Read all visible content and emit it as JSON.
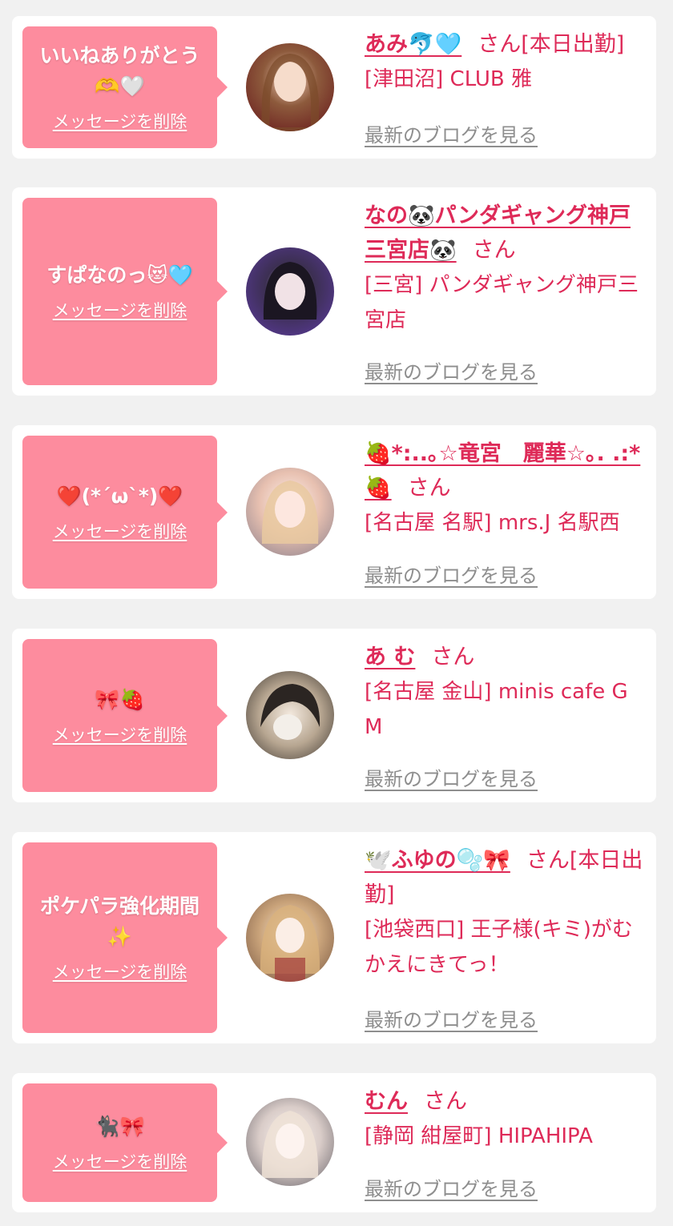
{
  "colors": {
    "page_bg": "#f1f1f1",
    "card_bg": "#ffffff",
    "bubble_bg": "#fd8c9e",
    "accent": "#de2a58",
    "muted": "#8e8e8e"
  },
  "delete_label": "メッセージを削除",
  "blog_label": "最新のブログを見る",
  "honorific": "さん",
  "items": [
    {
      "message": "いいねありがとう🫶🤍",
      "cast_name": "あみ🐬🩵",
      "status": "[本日出勤]",
      "shop": "[津田沼] CLUB 雅",
      "avatar_icon": "avatar-photo"
    },
    {
      "message": "すぱなのっ😻🩵",
      "cast_name": "なの🐼パンダギャング神戸三宮店🐼",
      "status": "",
      "shop": "[三宮] パンダギャング神戸三宮店",
      "avatar_icon": "avatar-photo"
    },
    {
      "message": "❤️(*´ω`*)❤️",
      "cast_name": "🍓*:..｡☆竜宮　麗華☆｡. .:*🍓",
      "status": "",
      "shop": "[名古屋 名駅] mrs.J 名駅西",
      "avatar_icon": "avatar-photo"
    },
    {
      "message": "🎀🍓",
      "cast_name": "あ む",
      "status": "",
      "shop": "[名古屋 金山] minis cafe GM",
      "avatar_icon": "avatar-photo"
    },
    {
      "message": "ポケパラ強化期間✨",
      "cast_name": "🕊️ふゆの🫧🎀",
      "status": "[本日出勤]",
      "shop": "[池袋西口] 王子様(キミ)がむかえにきてっ！",
      "avatar_icon": "avatar-photo"
    },
    {
      "message": "🐈‍⬛🎀",
      "cast_name": "むん",
      "status": "",
      "shop": "[静岡 紺屋町] HIPAHIPA",
      "avatar_icon": "avatar-photo"
    }
  ]
}
